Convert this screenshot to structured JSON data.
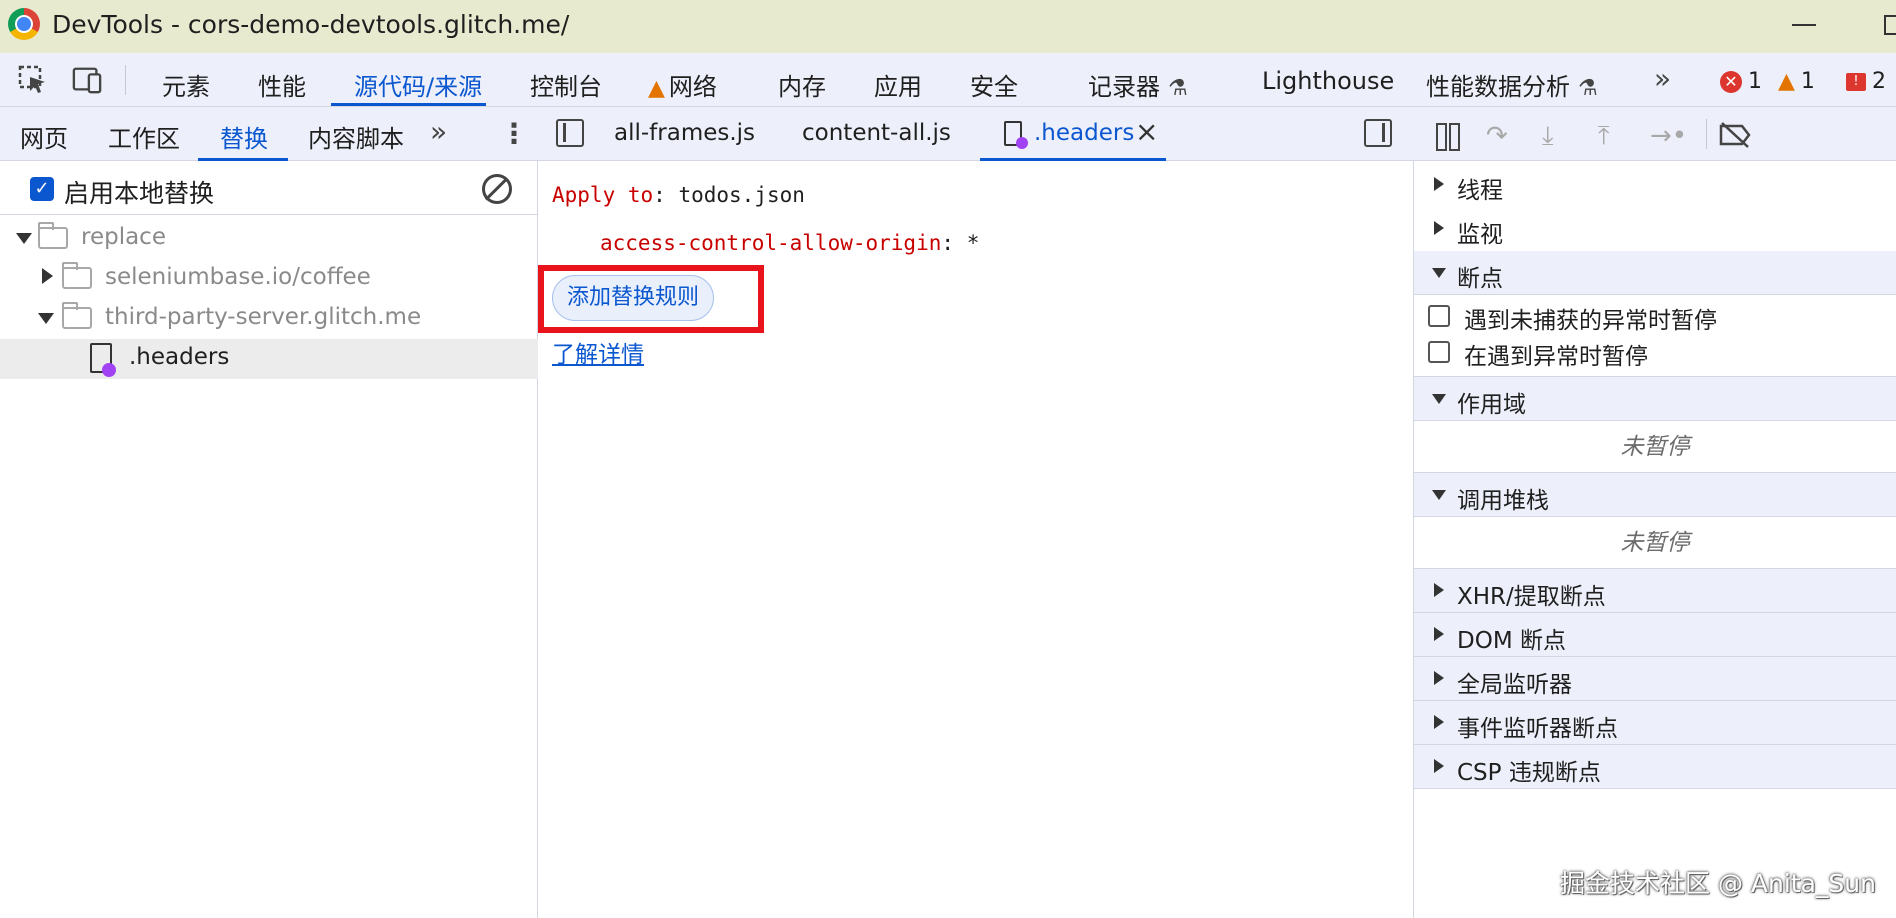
{
  "window": {
    "title": "DevTools - cors-demo-devtools.glitch.me/"
  },
  "main_tabs": [
    {
      "label": "元素"
    },
    {
      "label": "性能"
    },
    {
      "label": "源代码/来源"
    },
    {
      "label": "控制台"
    },
    {
      "label": "网络"
    },
    {
      "label": "内存"
    },
    {
      "label": "应用"
    },
    {
      "label": "安全"
    },
    {
      "label": "记录器"
    },
    {
      "label": "Lighthouse"
    },
    {
      "label": "性能数据分析"
    }
  ],
  "active_main_tab": "源代码/来源",
  "counters": {
    "errors": "1",
    "warnings": "1",
    "issues": "2"
  },
  "left_panel": {
    "tabs": [
      {
        "label": "网页"
      },
      {
        "label": "工作区"
      },
      {
        "label": "替换"
      },
      {
        "label": "内容脚本"
      }
    ],
    "active_tab": "替换",
    "enable_overrides": {
      "label": "启用本地替换",
      "checked": true
    },
    "tree": [
      {
        "label": "replace",
        "type": "folder",
        "expanded": true
      },
      {
        "label": "seleniumbase.io/coffee",
        "type": "folder",
        "expanded": false
      },
      {
        "label": "third-party-server.glitch.me",
        "type": "folder",
        "expanded": true
      },
      {
        "label": ".headers",
        "type": "file",
        "selected": true
      }
    ]
  },
  "editor": {
    "tabs": [
      {
        "label": "all-frames.js"
      },
      {
        "label": "content-all.js"
      },
      {
        "label": ".headers"
      }
    ],
    "active_tab": ".headers",
    "apply_to_key": "Apply to",
    "apply_to_sep": ":",
    "apply_to_value": "todos.json",
    "header_name": "access-control-allow-origin",
    "header_sep": ":",
    "header_value": "*",
    "add_rule_button": "添加替换规则",
    "learn_more_link": "了解详情"
  },
  "debugger": {
    "sections": {
      "threads": "线程",
      "watch": "监视",
      "breakpoints": "断点",
      "scope": "作用域",
      "call_stack": "调用堆栈",
      "xhr": "XHR/提取断点",
      "dom": "DOM 断点",
      "global": "全局监听器",
      "event": "事件监听器断点",
      "csp": "CSP 违规断点"
    },
    "pause_uncaught": "遇到未捕获的异常时暂停",
    "pause_caught": "在遇到异常时暂停",
    "scope_status": "未暂停",
    "callstack_status": "未暂停"
  },
  "watermark": "掘金技术社区 @ Anita_Sun",
  "colors": {
    "accent": "#0b57d0",
    "highlight_box": "#e8131b",
    "code_keyword": "#c80000",
    "toolbar_bg": "#edf0fa"
  }
}
